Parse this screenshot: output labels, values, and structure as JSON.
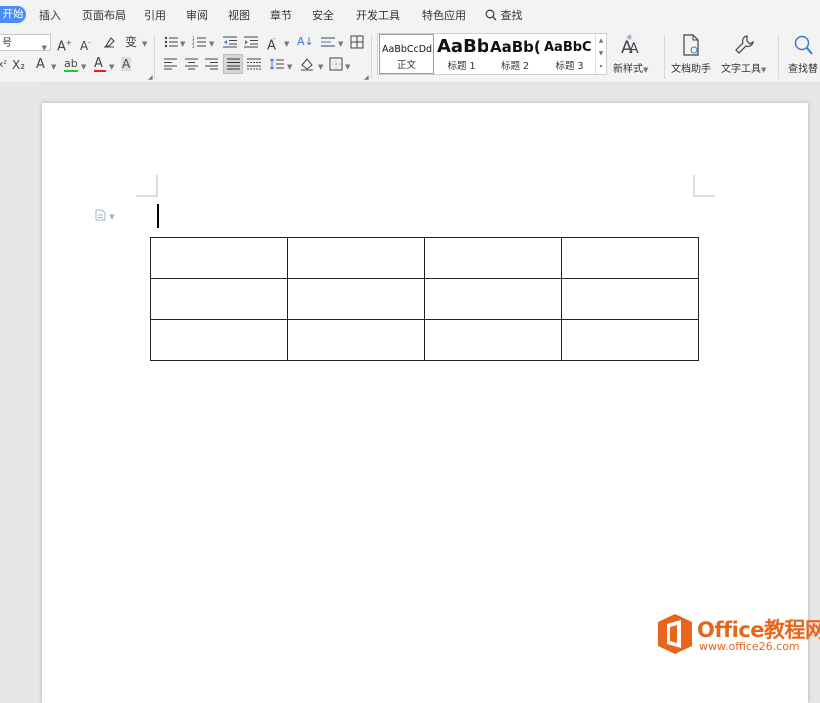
{
  "menu": {
    "tabs": [
      "开始",
      "插入",
      "页面布局",
      "引用",
      "审阅",
      "视图",
      "章节",
      "安全",
      "开发工具",
      "特色应用"
    ],
    "search_label": "查找"
  },
  "ribbon": {
    "font_size_value": "号",
    "styles": [
      {
        "sample": "AaBbCcDd",
        "name": "正文"
      },
      {
        "sample": "AaBb",
        "name": "标题 1"
      },
      {
        "sample": "AaBb(",
        "name": "标题 2"
      },
      {
        "sample": "AaBbC",
        "name": "标题 3"
      }
    ],
    "new_style_label": "新样式",
    "doc_assistant_label": "文档助手",
    "text_tools_label": "文字工具",
    "find_replace_label": "查找替"
  },
  "document": {
    "table": {
      "rows": 3,
      "cols": 4,
      "cells": [
        [
          "",
          "",
          "",
          ""
        ],
        [
          "",
          "",
          "",
          ""
        ],
        [
          "",
          "",
          "",
          ""
        ]
      ]
    }
  },
  "watermark": {
    "brand": "Office教程网",
    "url": "www.office26.com"
  },
  "colors": {
    "accent": "#4a8ef5",
    "watermark": "#e8651c",
    "highlight": "#22cc22",
    "font_color": "#e02020"
  }
}
